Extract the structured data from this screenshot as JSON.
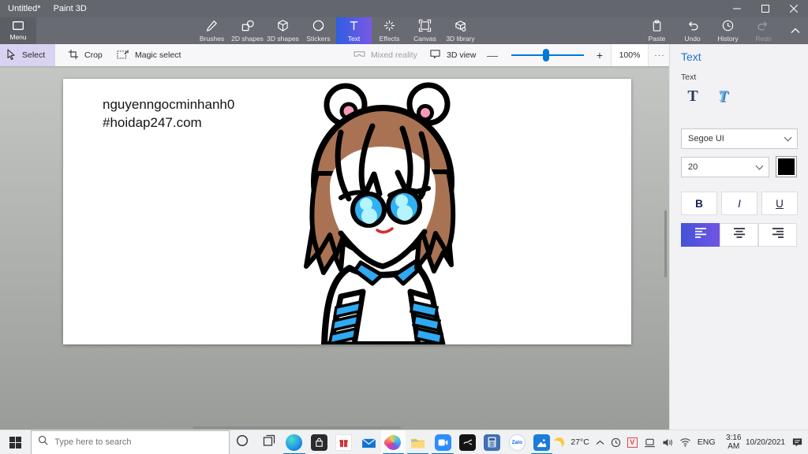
{
  "titlebar": {
    "title": "Untitled*",
    "app_name": "Paint 3D"
  },
  "toolbar": {
    "menu_label": "Menu",
    "tools": [
      {
        "label": "Brushes"
      },
      {
        "label": "2D shapes"
      },
      {
        "label": "3D shapes"
      },
      {
        "label": "Stickers"
      },
      {
        "label": "Text"
      },
      {
        "label": "Effects"
      },
      {
        "label": "Canvas"
      },
      {
        "label": "3D library"
      }
    ],
    "active_tool": "Text",
    "actions": [
      {
        "label": "Paste"
      },
      {
        "label": "Undo"
      },
      {
        "label": "History"
      },
      {
        "label": "Redo"
      }
    ]
  },
  "ribbon": {
    "select_label": "Select",
    "crop_label": "Crop",
    "magic_select_label": "Magic select",
    "mixed_reality_label": "Mixed reality",
    "view_3d_label": "3D view",
    "minus_label": "—",
    "plus_label": "+",
    "zoom_value": "100%",
    "more_label": "···"
  },
  "canvas": {
    "text_line1": "nguyenngocminhanh0",
    "text_line2": "#hoidap247.com",
    "drawing_description": "Cartoon girl with brown hair, white bear-ear headband with pink centers, large blue eyes, white sweater with blue V collar and blue striped sleeves"
  },
  "panel": {
    "title": "Text",
    "section_label": "Text",
    "font_name": "Segoe UI",
    "font_size": "20",
    "bold_label": "B",
    "italic_label": "I",
    "underline_label": "U"
  },
  "taskbar": {
    "search_placeholder": "Type here to search",
    "zalo_label": "Zalo",
    "apps": [
      "edge",
      "store",
      "gift",
      "mail",
      "paint-3d",
      "file-explorer",
      "zoom",
      "snip",
      "calculator",
      "zalo",
      "photos"
    ],
    "running_apps": [
      "edge",
      "paint-3d",
      "file-explorer",
      "zoom",
      "photos"
    ],
    "active_app": "paint-3d",
    "tray": {
      "temperature": "27°C",
      "language": "ENG",
      "time": "3:16 AM",
      "date": "10/20/2021"
    }
  },
  "colors": {
    "accent": "#0078d7",
    "tool_gradient_start": "#2e5ee0",
    "tool_gradient_end": "#7b58e6",
    "hair_brown": "#a97353",
    "eye_blue": "#2fb1f3",
    "stripe_blue": "#2fa9f2",
    "ear_pink": "#f59ab8"
  }
}
